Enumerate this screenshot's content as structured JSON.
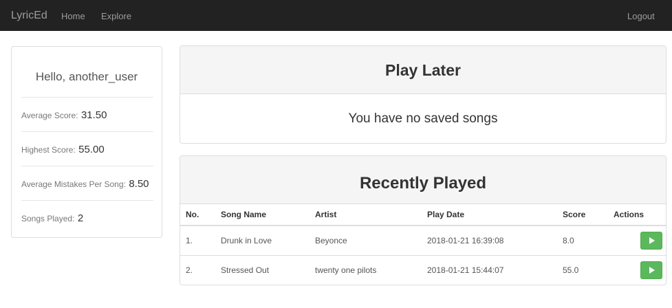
{
  "navbar": {
    "brand": "LyricEd",
    "links": [
      "Home",
      "Explore"
    ],
    "logout": "Logout"
  },
  "profile": {
    "greeting": "Hello, another_user",
    "stats": [
      {
        "label": "Average Score:",
        "value": "31.50"
      },
      {
        "label": "Highest Score:",
        "value": "55.00"
      },
      {
        "label": "Average Mistakes Per Song:",
        "value": "8.50"
      },
      {
        "label": "Songs Played:",
        "value": "2"
      }
    ]
  },
  "play_later": {
    "title": "Play Later",
    "empty_message": "You have no saved songs"
  },
  "recently_played": {
    "title": "Recently Played",
    "columns": [
      "No.",
      "Song Name",
      "Artist",
      "Play Date",
      "Score",
      "Actions"
    ],
    "rows": [
      {
        "no": "1.",
        "song": "Drunk in Love",
        "artist": "Beyonce",
        "date": "2018-01-21 16:39:08",
        "score": "8.0",
        "action": "play-icon"
      },
      {
        "no": "2.",
        "song": "Stressed Out",
        "artist": "twenty one pilots",
        "date": "2018-01-21 15:44:07",
        "score": "55.0",
        "action": "play-icon"
      }
    ]
  },
  "colors": {
    "navbar_bg": "#222222",
    "nav_text": "#9d9d9d",
    "play_button": "#5cb85c",
    "panel_heading_bg": "#f5f5f5"
  }
}
